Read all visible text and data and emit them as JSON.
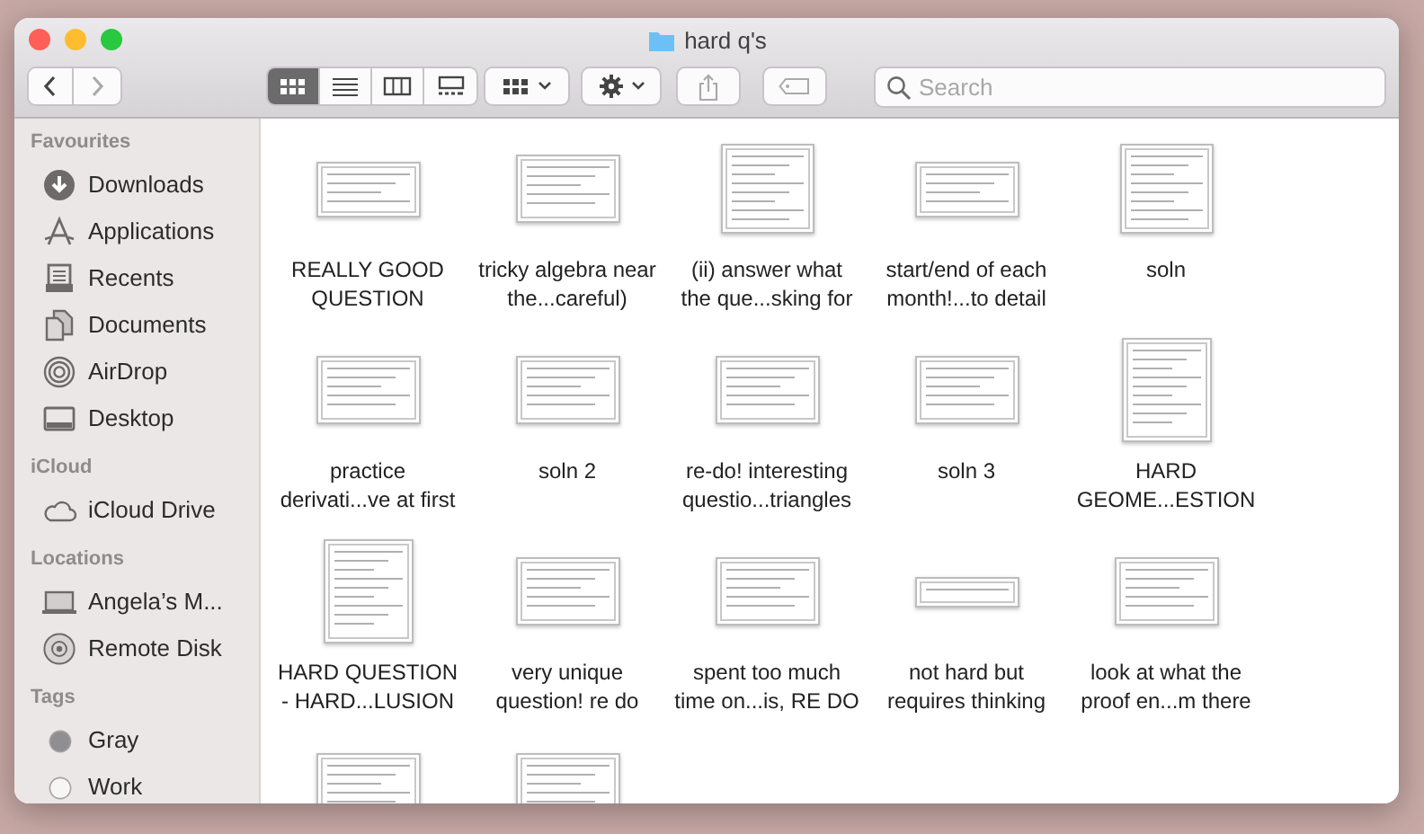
{
  "window": {
    "title": "hard q's"
  },
  "toolbar": {
    "view_modes": [
      {
        "kind": "icons",
        "selected": true
      },
      {
        "kind": "list",
        "selected": false
      },
      {
        "kind": "columns",
        "selected": false
      },
      {
        "kind": "gallery",
        "selected": false
      }
    ],
    "share_disabled": true
  },
  "search": {
    "placeholder": "Search"
  },
  "sidebar": {
    "sections": [
      {
        "title": "Favourites",
        "items": [
          {
            "label": "Downloads",
            "kind": "downloads"
          },
          {
            "label": "Applications",
            "kind": "applications"
          },
          {
            "label": "Recents",
            "kind": "recents"
          },
          {
            "label": "Documents",
            "kind": "documents"
          },
          {
            "label": "AirDrop",
            "kind": "airdrop"
          },
          {
            "label": "Desktop",
            "kind": "desktop"
          }
        ]
      },
      {
        "title": "iCloud",
        "items": [
          {
            "label": "iCloud Drive",
            "kind": "cloud"
          }
        ]
      },
      {
        "title": "Locations",
        "items": [
          {
            "label": "Angela’s M...",
            "kind": "laptop"
          },
          {
            "label": "Remote Disk",
            "kind": "disc"
          }
        ]
      },
      {
        "title": "Tags",
        "items": [
          {
            "label": "Gray",
            "kind": "tag",
            "color": "#8e8e93"
          },
          {
            "label": "Work",
            "kind": "tag",
            "color": "#f7f6f6"
          }
        ]
      }
    ]
  },
  "files": [
    {
      "label": "REALLY GOOD QUESTION",
      "kind": "wide"
    },
    {
      "label": "tricky algebra near the...careful)",
      "kind": "landscape"
    },
    {
      "label": "(ii) answer what the que...sking for",
      "kind": "square"
    },
    {
      "label": "start/end of each month!...to detail",
      "kind": "wide"
    },
    {
      "label": "soln",
      "kind": "square"
    },
    {
      "label": "practice derivati...ve at first",
      "kind": "landscape"
    },
    {
      "label": "soln 2",
      "kind": "landscape"
    },
    {
      "label": "re-do! interesting questio...triangles",
      "kind": "landscape"
    },
    {
      "label": "soln 3",
      "kind": "landscape"
    },
    {
      "label": "HARD GEOME...ESTION",
      "kind": "portrait"
    },
    {
      "label": "HARD QUESTION - HARD...LUSION",
      "kind": "portrait"
    },
    {
      "label": "very unique question! re do",
      "kind": "landscape"
    },
    {
      "label": "spent too much time on...is, RE DO",
      "kind": "landscape"
    },
    {
      "label": "not hard but requires thinking",
      "kind": "strip"
    },
    {
      "label": "look at what the proof en...m there",
      "kind": "landscape"
    },
    {
      "kind": "cut"
    },
    {
      "kind": "cut"
    }
  ]
}
